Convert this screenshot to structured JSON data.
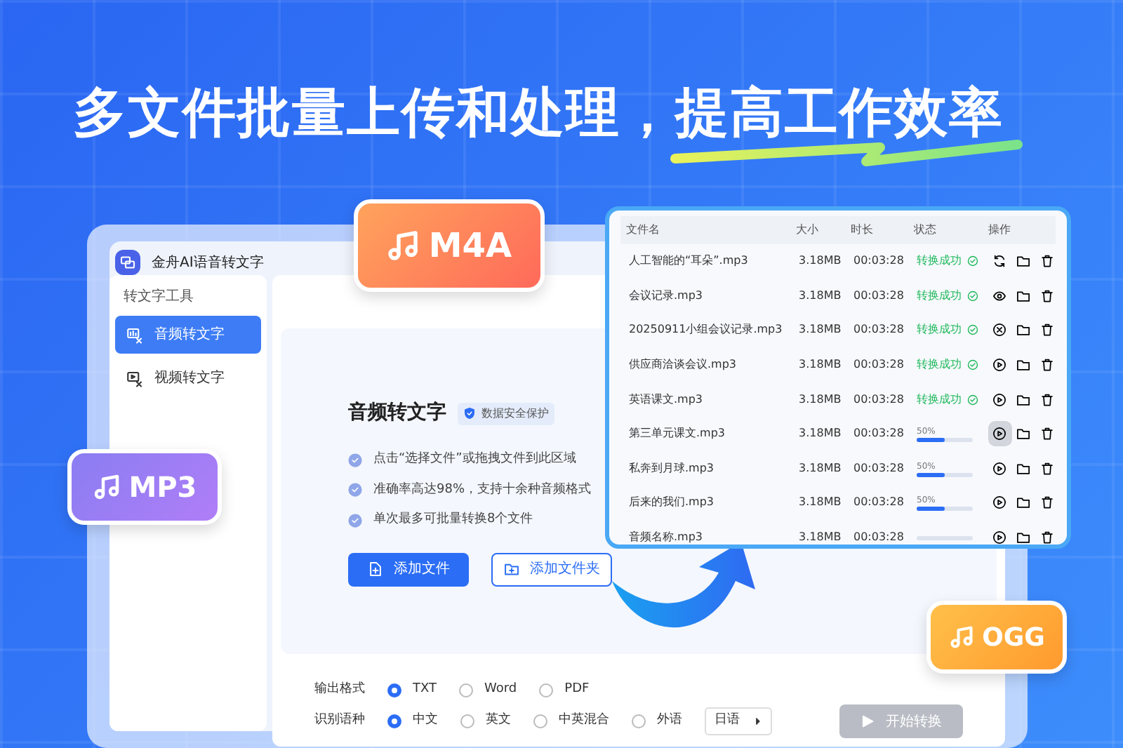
{
  "headline": {
    "text": "多文件批量上传和处理，",
    "highlight": "提高工作效率"
  },
  "format_badges": [
    {
      "label": "M4A",
      "color": "#ff7a59"
    },
    {
      "label": "MP3",
      "color": "#9b7bf5"
    },
    {
      "label": "OGG",
      "color": "#ffaa3b"
    }
  ],
  "app": {
    "title": "金舟AI语音转文字",
    "sidebar": {
      "heading": "转文字工具",
      "items": [
        {
          "label": "音频转文字",
          "selected": true
        },
        {
          "label": "视频转文字",
          "selected": false
        }
      ]
    },
    "upload": {
      "title": "音频转文字",
      "badge": "数据安全保护",
      "bullets": [
        "点击“选择文件”或拖拽文件到此区域",
        "准确率高达98%，支持十余种音频格式",
        "单次最多可批量转换8个文件"
      ],
      "buttons": [
        {
          "label": "添加文件",
          "kind": "primary"
        },
        {
          "label": "添加文件夹",
          "kind": "outline"
        }
      ]
    },
    "output_format": {
      "label": "输出格式",
      "choices": [
        {
          "label": "TXT",
          "selected": true
        },
        {
          "label": "Word",
          "selected": false
        },
        {
          "label": "PDF",
          "selected": false
        }
      ]
    },
    "language": {
      "label": "识别语种",
      "choices": [
        {
          "label": "中文",
          "selected": true
        },
        {
          "label": "英文",
          "selected": false
        },
        {
          "label": "中英混合",
          "selected": false
        },
        {
          "label": "外语",
          "selected": false
        }
      ],
      "dropdown": "日语"
    },
    "start_button": {
      "label": "开始转换",
      "disabled": true
    }
  },
  "file_table": {
    "columns": [
      "文件名",
      "大小",
      "时长",
      "状态",
      "操作"
    ],
    "rows": [
      {
        "name": "人工智能的“耳朵”.mp3",
        "size": "3.18MB",
        "duration": "00:03:28",
        "status": {
          "kind": "done",
          "text": "转换成功"
        },
        "kind": "refresh",
        "hovered": false
      },
      {
        "name": "会议记录.mp3",
        "size": "3.18MB",
        "duration": "00:03:28",
        "status": {
          "kind": "done",
          "text": "转换成功"
        },
        "kind": "view",
        "hovered": false
      },
      {
        "name": "20250911小组会议记录.mp3",
        "size": "3.18MB",
        "duration": "00:03:28",
        "status": {
          "kind": "done",
          "text": "转换成功"
        },
        "kind": "cancel",
        "hovered": false
      },
      {
        "name": "供应商洽谈会议.mp3",
        "size": "3.18MB",
        "duration": "00:03:28",
        "status": {
          "kind": "done",
          "text": "转换成功"
        },
        "kind": "play",
        "hovered": false
      },
      {
        "name": "英语课文.mp3",
        "size": "3.18MB",
        "duration": "00:03:28",
        "status": {
          "kind": "done",
          "text": "转换成功"
        },
        "kind": "play",
        "hovered": false
      },
      {
        "name": "第三单元课文.mp3",
        "size": "3.18MB",
        "duration": "00:03:28",
        "status": {
          "kind": "progress",
          "text": "50%",
          "level": 0.5
        },
        "kind": "play",
        "hovered": true
      },
      {
        "name": "私奔到月球.mp3",
        "size": "3.18MB",
        "duration": "00:03:28",
        "status": {
          "kind": "progress",
          "text": "50%",
          "level": 0.5
        },
        "kind": "play",
        "hovered": false
      },
      {
        "name": "后来的我们.mp3",
        "size": "3.18MB",
        "duration": "00:03:28",
        "status": {
          "kind": "progress",
          "text": "50%",
          "level": 0.5
        },
        "kind": "play",
        "hovered": false
      },
      {
        "name": "音频名称.mp3",
        "size": "3.18MB",
        "duration": "00:03:28",
        "status": {
          "kind": "waiting"
        },
        "kind": "play",
        "hovered": false
      }
    ]
  }
}
